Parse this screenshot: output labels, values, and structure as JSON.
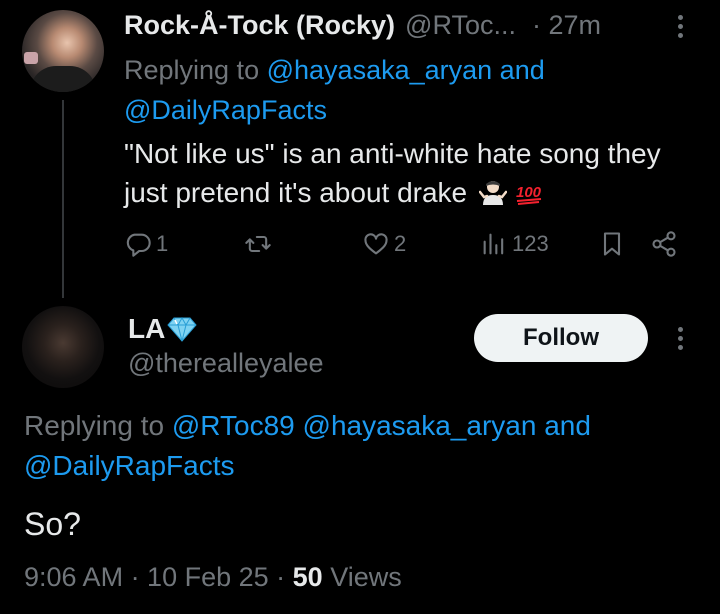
{
  "reply_tweet": {
    "author_name": "Rock-Å-Tock (Rocky)",
    "author_handle": "@RToc...",
    "time": "· 27m",
    "replying_prefix": "Replying to",
    "replying_to_1": "@hayasaka_aryan",
    "replying_and": "and",
    "replying_to_2": "@DailyRapFacts",
    "text": "\"Not like us\" is an anti-white hate song they just pretend it's about drake",
    "actions": {
      "reply_count": "1",
      "retweet_count": "",
      "like_count": "2",
      "view_count": "123"
    }
  },
  "main_tweet": {
    "author_name": "LA",
    "author_handle": "@therealleyalee",
    "follow_label": "Follow",
    "replying_prefix": "Replying to",
    "replying_to_1": "@RToc89",
    "replying_to_2": "@hayasaka_aryan",
    "replying_and": "and",
    "replying_to_3": "@DailyRapFacts",
    "text": "So?",
    "timestamp": "9:06 AM · 10 Feb 25 · ",
    "views_count": "50",
    "views_label": "Views"
  },
  "colors": {
    "background": "#000000",
    "primary_text": "#e7e9ea",
    "secondary_text": "#71767b",
    "link": "#1d9bf0",
    "follow_button_bg": "#eff3f4"
  },
  "icons": [
    "reply-icon",
    "retweet-icon",
    "like-icon",
    "views-icon",
    "bookmark-icon",
    "share-icon",
    "more-icon",
    "gem-icon",
    "shrug-emoji",
    "hundred-emoji"
  ]
}
